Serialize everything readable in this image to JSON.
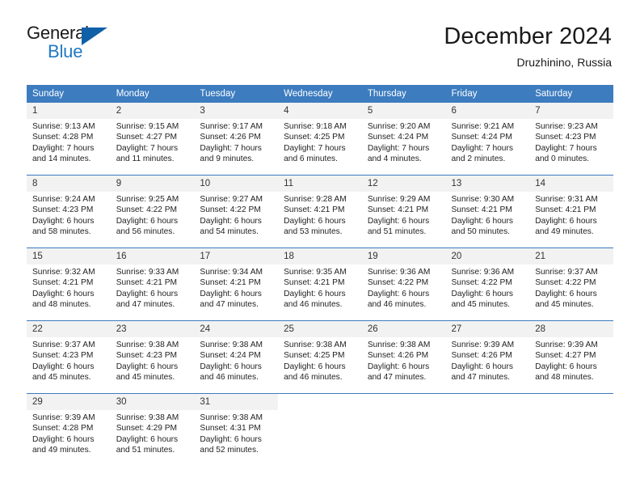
{
  "brand": {
    "name_top": "General",
    "name_bottom": "Blue",
    "logo_icon": "blue-triangle-icon",
    "color_dark": "#1a1a1a",
    "color_blue": "#2079c4"
  },
  "header": {
    "title": "December 2024",
    "subtitle": "Druzhinino, Russia"
  },
  "theme": {
    "header_row_bg": "#3c7cbf",
    "daynum_bg": "#f2f2f2",
    "grid_line": "#3c7cbf",
    "text": "#1f1f1f"
  },
  "weekdays": [
    "Sunday",
    "Monday",
    "Tuesday",
    "Wednesday",
    "Thursday",
    "Friday",
    "Saturday"
  ],
  "labels": {
    "sunrise_prefix": "Sunrise:",
    "sunset_prefix": "Sunset:",
    "daylight_prefix": "Daylight:"
  },
  "weeks": [
    [
      {
        "day": "1",
        "sunrise": "Sunrise: 9:13 AM",
        "sunset": "Sunset: 4:28 PM",
        "daylight1": "Daylight: 7 hours",
        "daylight2": "and 14 minutes."
      },
      {
        "day": "2",
        "sunrise": "Sunrise: 9:15 AM",
        "sunset": "Sunset: 4:27 PM",
        "daylight1": "Daylight: 7 hours",
        "daylight2": "and 11 minutes."
      },
      {
        "day": "3",
        "sunrise": "Sunrise: 9:17 AM",
        "sunset": "Sunset: 4:26 PM",
        "daylight1": "Daylight: 7 hours",
        "daylight2": "and 9 minutes."
      },
      {
        "day": "4",
        "sunrise": "Sunrise: 9:18 AM",
        "sunset": "Sunset: 4:25 PM",
        "daylight1": "Daylight: 7 hours",
        "daylight2": "and 6 minutes."
      },
      {
        "day": "5",
        "sunrise": "Sunrise: 9:20 AM",
        "sunset": "Sunset: 4:24 PM",
        "daylight1": "Daylight: 7 hours",
        "daylight2": "and 4 minutes."
      },
      {
        "day": "6",
        "sunrise": "Sunrise: 9:21 AM",
        "sunset": "Sunset: 4:24 PM",
        "daylight1": "Daylight: 7 hours",
        "daylight2": "and 2 minutes."
      },
      {
        "day": "7",
        "sunrise": "Sunrise: 9:23 AM",
        "sunset": "Sunset: 4:23 PM",
        "daylight1": "Daylight: 7 hours",
        "daylight2": "and 0 minutes."
      }
    ],
    [
      {
        "day": "8",
        "sunrise": "Sunrise: 9:24 AM",
        "sunset": "Sunset: 4:23 PM",
        "daylight1": "Daylight: 6 hours",
        "daylight2": "and 58 minutes."
      },
      {
        "day": "9",
        "sunrise": "Sunrise: 9:25 AM",
        "sunset": "Sunset: 4:22 PM",
        "daylight1": "Daylight: 6 hours",
        "daylight2": "and 56 minutes."
      },
      {
        "day": "10",
        "sunrise": "Sunrise: 9:27 AM",
        "sunset": "Sunset: 4:22 PM",
        "daylight1": "Daylight: 6 hours",
        "daylight2": "and 54 minutes."
      },
      {
        "day": "11",
        "sunrise": "Sunrise: 9:28 AM",
        "sunset": "Sunset: 4:21 PM",
        "daylight1": "Daylight: 6 hours",
        "daylight2": "and 53 minutes."
      },
      {
        "day": "12",
        "sunrise": "Sunrise: 9:29 AM",
        "sunset": "Sunset: 4:21 PM",
        "daylight1": "Daylight: 6 hours",
        "daylight2": "and 51 minutes."
      },
      {
        "day": "13",
        "sunrise": "Sunrise: 9:30 AM",
        "sunset": "Sunset: 4:21 PM",
        "daylight1": "Daylight: 6 hours",
        "daylight2": "and 50 minutes."
      },
      {
        "day": "14",
        "sunrise": "Sunrise: 9:31 AM",
        "sunset": "Sunset: 4:21 PM",
        "daylight1": "Daylight: 6 hours",
        "daylight2": "and 49 minutes."
      }
    ],
    [
      {
        "day": "15",
        "sunrise": "Sunrise: 9:32 AM",
        "sunset": "Sunset: 4:21 PM",
        "daylight1": "Daylight: 6 hours",
        "daylight2": "and 48 minutes."
      },
      {
        "day": "16",
        "sunrise": "Sunrise: 9:33 AM",
        "sunset": "Sunset: 4:21 PM",
        "daylight1": "Daylight: 6 hours",
        "daylight2": "and 47 minutes."
      },
      {
        "day": "17",
        "sunrise": "Sunrise: 9:34 AM",
        "sunset": "Sunset: 4:21 PM",
        "daylight1": "Daylight: 6 hours",
        "daylight2": "and 47 minutes."
      },
      {
        "day": "18",
        "sunrise": "Sunrise: 9:35 AM",
        "sunset": "Sunset: 4:21 PM",
        "daylight1": "Daylight: 6 hours",
        "daylight2": "and 46 minutes."
      },
      {
        "day": "19",
        "sunrise": "Sunrise: 9:36 AM",
        "sunset": "Sunset: 4:22 PM",
        "daylight1": "Daylight: 6 hours",
        "daylight2": "and 46 minutes."
      },
      {
        "day": "20",
        "sunrise": "Sunrise: 9:36 AM",
        "sunset": "Sunset: 4:22 PM",
        "daylight1": "Daylight: 6 hours",
        "daylight2": "and 45 minutes."
      },
      {
        "day": "21",
        "sunrise": "Sunrise: 9:37 AM",
        "sunset": "Sunset: 4:22 PM",
        "daylight1": "Daylight: 6 hours",
        "daylight2": "and 45 minutes."
      }
    ],
    [
      {
        "day": "22",
        "sunrise": "Sunrise: 9:37 AM",
        "sunset": "Sunset: 4:23 PM",
        "daylight1": "Daylight: 6 hours",
        "daylight2": "and 45 minutes."
      },
      {
        "day": "23",
        "sunrise": "Sunrise: 9:38 AM",
        "sunset": "Sunset: 4:23 PM",
        "daylight1": "Daylight: 6 hours",
        "daylight2": "and 45 minutes."
      },
      {
        "day": "24",
        "sunrise": "Sunrise: 9:38 AM",
        "sunset": "Sunset: 4:24 PM",
        "daylight1": "Daylight: 6 hours",
        "daylight2": "and 46 minutes."
      },
      {
        "day": "25",
        "sunrise": "Sunrise: 9:38 AM",
        "sunset": "Sunset: 4:25 PM",
        "daylight1": "Daylight: 6 hours",
        "daylight2": "and 46 minutes."
      },
      {
        "day": "26",
        "sunrise": "Sunrise: 9:38 AM",
        "sunset": "Sunset: 4:26 PM",
        "daylight1": "Daylight: 6 hours",
        "daylight2": "and 47 minutes."
      },
      {
        "day": "27",
        "sunrise": "Sunrise: 9:39 AM",
        "sunset": "Sunset: 4:26 PM",
        "daylight1": "Daylight: 6 hours",
        "daylight2": "and 47 minutes."
      },
      {
        "day": "28",
        "sunrise": "Sunrise: 9:39 AM",
        "sunset": "Sunset: 4:27 PM",
        "daylight1": "Daylight: 6 hours",
        "daylight2": "and 48 minutes."
      }
    ],
    [
      {
        "day": "29",
        "sunrise": "Sunrise: 9:39 AM",
        "sunset": "Sunset: 4:28 PM",
        "daylight1": "Daylight: 6 hours",
        "daylight2": "and 49 minutes."
      },
      {
        "day": "30",
        "sunrise": "Sunrise: 9:38 AM",
        "sunset": "Sunset: 4:29 PM",
        "daylight1": "Daylight: 6 hours",
        "daylight2": "and 51 minutes."
      },
      {
        "day": "31",
        "sunrise": "Sunrise: 9:38 AM",
        "sunset": "Sunset: 4:31 PM",
        "daylight1": "Daylight: 6 hours",
        "daylight2": "and 52 minutes."
      },
      {
        "day": "",
        "sunrise": "",
        "sunset": "",
        "daylight1": "",
        "daylight2": ""
      },
      {
        "day": "",
        "sunrise": "",
        "sunset": "",
        "daylight1": "",
        "daylight2": ""
      },
      {
        "day": "",
        "sunrise": "",
        "sunset": "",
        "daylight1": "",
        "daylight2": ""
      },
      {
        "day": "",
        "sunrise": "",
        "sunset": "",
        "daylight1": "",
        "daylight2": ""
      }
    ]
  ]
}
